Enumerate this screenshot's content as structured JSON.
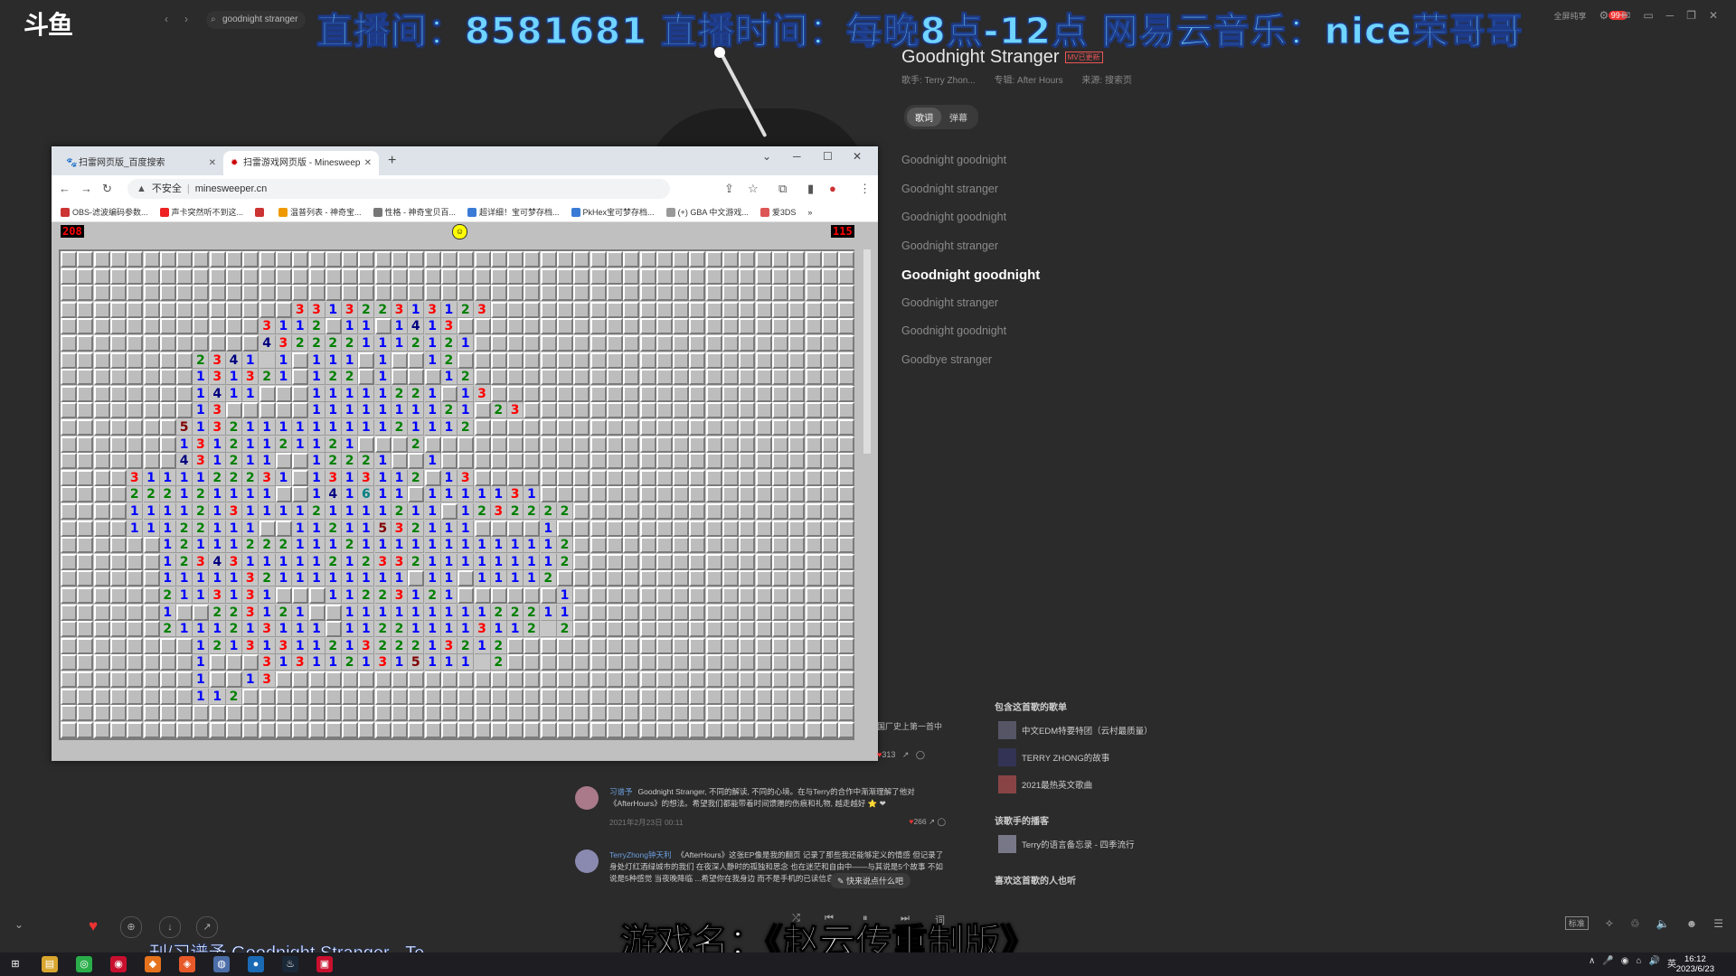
{
  "app": {
    "logo": "斗鱼",
    "search_query": "goodnight stranger",
    "overlay_top": "直播间：8581681 直播时间：每晚8点-12点 网易云音乐：nice荣哥哥",
    "overlay_bottom": "游戏名：《赵云传重制版》",
    "notif_badge": "99+",
    "fullscreen_label": "全屏纯享"
  },
  "song": {
    "title": "Goodnight Stranger",
    "tag": "MV已更新",
    "singer": "歌手: Terry Zhon...",
    "album": "专辑: After Hours",
    "source": "来源: 搜索页",
    "tabs": [
      "歌词",
      "弹幕"
    ],
    "lyrics": [
      "Goodnight goodnight",
      "Goodnight stranger",
      "Goodnight goodnight",
      "Goodnight stranger",
      "Goodnight goodnight",
      "Goodnight stranger",
      "Goodnight goodnight",
      "Goodbye stranger"
    ],
    "current_lyric_index": 4
  },
  "browser": {
    "tabs": [
      {
        "label": "扫雷网页版_百度搜索",
        "active": false
      },
      {
        "label": "扫雷游戏网页版 - Minesweep",
        "active": true
      }
    ],
    "url_warning": "不安全",
    "url": "minesweeper.cn",
    "bookmarks": [
      "OBS-滤波编码参数...",
      "声卡突然听不到这...",
      "",
      "温普列表 - 神奇宝...",
      "性格 - 神奇宝贝百...",
      "超详细！宝可梦存档...",
      "PkHex宝可梦存档...",
      "(+) GBA 中文游戏...",
      "爱3DS"
    ],
    "bookmark_more": "»"
  },
  "minesweeper": {
    "mines_left": "208",
    "timer": "115",
    "face": "☺",
    "cols": 48,
    "rows": 29,
    "board": [
      "................................................",
      "................................................",
      "................................................",
      "..............331322313123......................",
      "............3112.11.1413......................",
      "............4322221112121.........................",
      "........2341-1.111.1..12........................",
      "........131321.122.1...12.......................",
      "........1411...11111221.13......................",
      "........13.....1111111121.23......................",
      ".......513211111111121112.......................",
      ".......13121121121...2..........................",
      ".......431211..12221..1.........................",
      "....3111122231.1313112.13......................",
      "....222121111..141611.1111131...................",
      "....1111213111121111211.1232222.................",
      "....11122111..11211532111....1..................",
      "......1211122211121111111111112.................",
      "......1234311111212332111111112.................",
      "......111113211111111.11.11112..................",
      "......2113131...11223121......1.................",
      "......1..223121..11111111122211.................",
      "......2111213111.112211113112 2.................",
      "........1213131121322213212.....................",
      "........1...3131121315111 2.....................",
      "........1..13....................................",
      "........112......................................",
      "................................................",
      "................................................"
    ]
  },
  "comments": {
    "section_label": "国厂史上第一首中",
    "items": [
      {
        "user": "习谱予",
        "text": "Goodnight Stranger, 不同的解读, 不同的心境。在与Terry的合作中渐渐理解了他对《AfterHours》的想法。希望我们都能带着时间馈赠的伤痕和礼物, 越走越好 ⭐ ❤",
        "date": "2021年2月23日 00:11",
        "likes": "266"
      },
      {
        "user": "TerryZhong钟天利",
        "text": "《AfterHours》这张EP像是我的翻页 记录了那些我还能够定义的情感 但记录了身处灯红酒绿城市的我们 在夜深人静时的孤独和思念 也在迷茫和自由中——与其说是5个故事 不如说是5种感觉 当夜晚降临 ...希望你在我身边 而不是手机的已读信息里",
        "date": "",
        "likes": ""
      }
    ],
    "first_likes": "313",
    "write_prompt": "快来说点什么吧"
  },
  "sidebar": {
    "playlists_title": "包含这首歌的歌单",
    "playlists": [
      "中文EDM特要特团（云村最质量）",
      "TERRY ZHONG的故事",
      "2021最热英文歌曲"
    ],
    "podcasts_title": "该歌手的播客",
    "podcasts": [
      "Terry的语言备忘录 - 四季流行"
    ],
    "also_like_title": "喜欢这首歌的人也听"
  },
  "player": {
    "now_playing": "刊/习谱予  Goodnight Stranger - Te",
    "quality": "标准"
  },
  "taskbar": {
    "time": "16:12",
    "date": "2023/6/23",
    "ime": "英"
  },
  "colors": {
    "num1": "#0000ff",
    "num2": "#008000",
    "num3": "#ff0000",
    "num4": "#000080",
    "num5": "#800000",
    "num6": "#008080",
    "overlay_blue": "#6fd4ff",
    "link_blue": "#6b9fe0"
  }
}
